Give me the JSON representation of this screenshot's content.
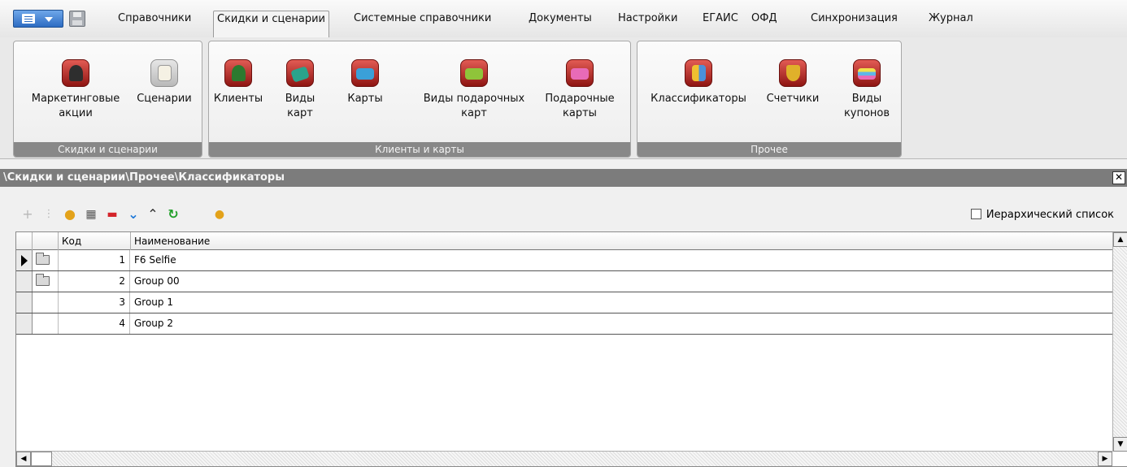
{
  "menu": {
    "items": [
      "Справочники",
      "Скидки и сценарии",
      "Системные справочники",
      "Документы",
      "Настройки",
      "ЕГАИС",
      "ОФД",
      "Синхронизация",
      "Журнал"
    ],
    "active": "Скидки и сценарии"
  },
  "ribbon": {
    "groups": [
      {
        "caption": "Скидки и сценарии",
        "buttons": [
          {
            "label": "Маркетинговые акции",
            "icon": "graduate-icon"
          },
          {
            "label": "Сценарии",
            "icon": "scenario-book-icon"
          }
        ]
      },
      {
        "caption": "Клиенты и карты",
        "buttons": [
          {
            "label": "Клиенты",
            "icon": "client-person-icon"
          },
          {
            "label": "Виды карт",
            "icon": "card-types-icon"
          },
          {
            "label": "Карты",
            "icon": "discount-card-icon"
          },
          {
            "label": "Виды подарочных карт",
            "icon": "gift-card-types-icon"
          },
          {
            "label": "Подарочные карты",
            "icon": "gift-card-icon"
          }
        ]
      },
      {
        "caption": "Прочее",
        "buttons": [
          {
            "label": "Классификаторы",
            "icon": "classifier-icon"
          },
          {
            "label": "Счетчики",
            "icon": "counter-trophy-icon"
          },
          {
            "label": "Виды купонов",
            "icon": "coupons-stack-icon"
          }
        ]
      }
    ]
  },
  "breadcrumb": "\\Скидки и сценарии\\Прочее\\Классификаторы",
  "toolbar": {
    "icons": [
      "add-icon",
      "add-child-icon",
      "edit-icon",
      "copy-icon",
      "delete-icon",
      "move-down-icon",
      "move-up-icon",
      "refresh-icon",
      "remove-db-icon"
    ]
  },
  "hierarchical_label": "Иерархический список",
  "grid": {
    "columns": [
      "Код",
      "Наименование"
    ],
    "rows": [
      {
        "code": "1",
        "name": "F6 Selfie",
        "folder": true,
        "current": true
      },
      {
        "code": "2",
        "name": "Group 00",
        "folder": true,
        "current": false
      },
      {
        "code": "3",
        "name": "Group 1",
        "folder": false,
        "current": false
      },
      {
        "code": "4",
        "name": "Group 2",
        "folder": false,
        "current": false
      }
    ]
  },
  "colors": {
    "ribbon_icon_red": "#b72a25",
    "caption_gray": "#888888",
    "crumb_gray": "#7c7c7c",
    "refresh_green": "#22a02a",
    "chevron_blue": "#1e78d8",
    "delete_red": "#d4242a"
  }
}
